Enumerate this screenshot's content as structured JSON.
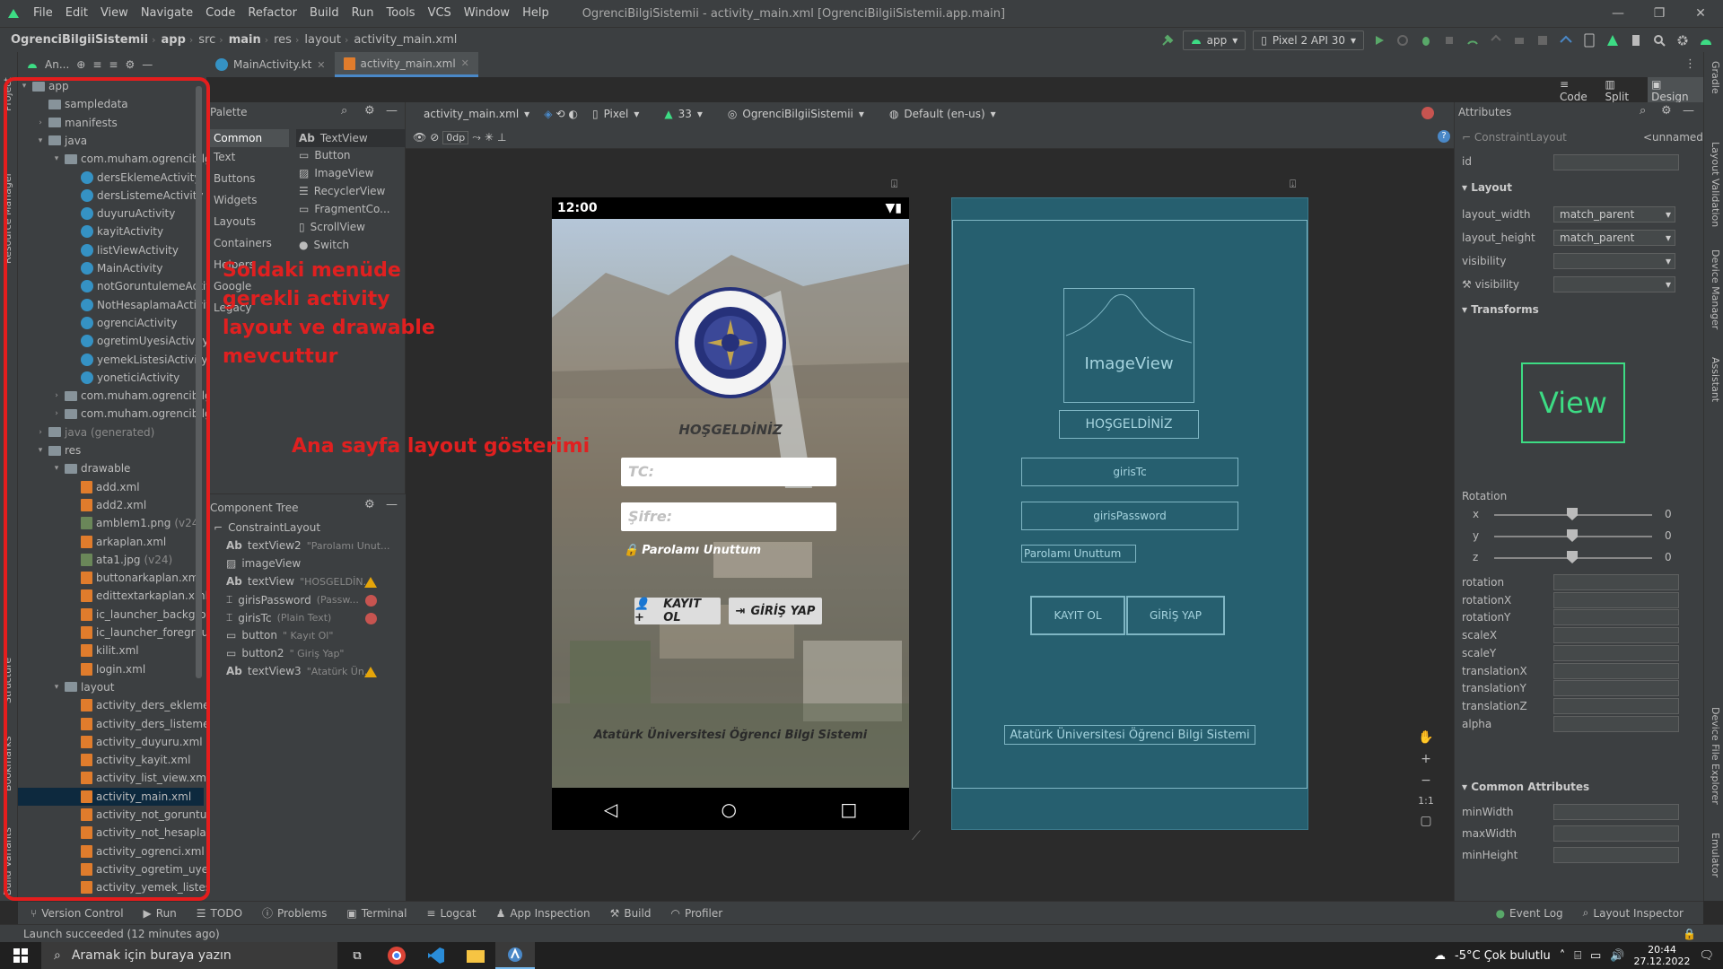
{
  "menubar": {
    "items": [
      "File",
      "Edit",
      "View",
      "Navigate",
      "Code",
      "Refactor",
      "Build",
      "Run",
      "Tools",
      "VCS",
      "Window",
      "Help"
    ],
    "window_title": "OgrenciBilgiSistemii - activity_main.xml [OgrenciBilgiiSistemii.app.main]"
  },
  "breadcrumb": [
    "OgrenciBilgiiSistemii",
    "app",
    "src",
    "main",
    "res",
    "layout",
    "activity_main.xml"
  ],
  "toolbar": {
    "run_config": "app",
    "device": "Pixel 2 API 30"
  },
  "project_tool": {
    "label": "An..."
  },
  "editor_tabs": [
    {
      "label": "MainActivity.kt"
    },
    {
      "label": "activity_main.xml"
    }
  ],
  "view_modes": {
    "code": "Code",
    "split": "Split",
    "design": "Design"
  },
  "left_strip": {
    "project": "Project",
    "resource_manager": "Resource Manager",
    "structure": "Structure",
    "bookmarks": "Bookmarks",
    "build_variants": "Build Variants"
  },
  "right_strip": {
    "gradle": "Gradle",
    "layout_validation": "Layout Validation",
    "device_manager": "Device Manager",
    "assistant": "Assistant",
    "device_file_explorer": "Device File Explorer",
    "emulator": "Emulator"
  },
  "tree": {
    "app": "app",
    "sampledata": "sampledata",
    "manifests": "manifests",
    "java": "java",
    "pkg_main": "com.muham.ogrencibilgiisist",
    "activities": [
      "dersEklemeActivity",
      "dersListemeActivity",
      "duyuruActivity",
      "kayitActivity",
      "listViewActivity",
      "MainActivity",
      "notGoruntulemeActivity",
      "NotHesaplamaActivity",
      "ogrenciActivity",
      "ogretimUyesiActivity",
      "yemekListesiActivity",
      "yoneticiActivity"
    ],
    "pkg_test1": "com.muham.ogrencibilgiisist",
    "pkg_test2": "com.muham.ogrencibilgiisist",
    "java_generated": "java (generated)",
    "res": "res",
    "drawable": "drawable",
    "drawables": [
      "add.xml",
      "add2.xml",
      "amblem1.png",
      "arkaplan.xml",
      "ata1.jpg",
      "buttonarkaplan.xml",
      "edittextarkaplan.xml",
      "ic_launcher_background.x",
      "ic_launcher_foreground.x",
      "kilit.xml",
      "login.xml"
    ],
    "v24": "(v24)",
    "layout": "layout",
    "layouts": [
      "activity_ders_ekleme.xml",
      "activity_ders_listeme.xml",
      "activity_duyuru.xml",
      "activity_kayit.xml",
      "activity_list_view.xml",
      "activity_main.xml",
      "activity_not_goruntuleme",
      "activity_not_hesaplama.xr",
      "activity_ogrenci.xml",
      "activity_ogretim_uyesi.xm",
      "activity_yemek_listesi.xml",
      "activity_yonetici.xml"
    ]
  },
  "palette": {
    "title": "Palette",
    "categories": [
      "Common",
      "Text",
      "Buttons",
      "Widgets",
      "Layouts",
      "Containers",
      "Helpers",
      "Google",
      "Legacy"
    ],
    "items": [
      "TextView",
      "Button",
      "ImageView",
      "RecyclerView",
      "FragmentCo...",
      "ScrollView",
      "Switch"
    ]
  },
  "component_tree": {
    "title": "Component Tree",
    "root": "ConstraintLayout",
    "rows": [
      {
        "name": "textView2",
        "hint": "\"Parolamı Unut..."
      },
      {
        "name": "imageView",
        "hint": ""
      },
      {
        "name": "textView",
        "hint": "\"HOSGELDİN..."
      },
      {
        "name": "girisPassword",
        "hint": "(Passw..."
      },
      {
        "name": "girisTc",
        "hint": "(Plain Text)"
      },
      {
        "name": "button",
        "hint": "\" Kayıt Ol\""
      },
      {
        "name": "button2",
        "hint": "\" Giriş Yap\""
      },
      {
        "name": "textView3",
        "hint": "\"Atatürk Ün..."
      }
    ]
  },
  "design_toolbar": {
    "file": "activity_main.xml",
    "device": "Pixel",
    "api": "33",
    "theme": "OgrenciBilgiiSistemii",
    "locale": "Default (en-us)",
    "margin": "0dp"
  },
  "phone": {
    "time": "12:00",
    "welcome": "HOŞGELDİNİZ",
    "tc_hint": "TC:",
    "password_hint": "Şifre:",
    "forgot": "Parolamı Unuttum",
    "register": "KAYIT OL",
    "login": "GİRİŞ YAP",
    "footer": "Atatürk Üniversitesi Öğrenci Bilgi Sistemi",
    "logo_text": "Atatürk Üniversitesi · Atatürk University"
  },
  "blueprint": {
    "imageview": "ImageView",
    "welcome": "HOŞGELDİNİZ",
    "tc": "girisTc",
    "password": "girisPassword",
    "forgot": "Parolamı Unuttum",
    "register": "KAYIT OL",
    "login": "GİRİŞ YAP",
    "footer": "Atatürk Üniversitesi Öğrenci Bilgi Sistemi"
  },
  "zoom": {
    "ratio": "1:1"
  },
  "attributes": {
    "title": "Attributes",
    "selected": "ConstraintLayout",
    "unnamed": "<unnamed>",
    "id": "id",
    "layout_section": "Layout",
    "layout_width": "layout_width",
    "layout_width_value": "match_parent",
    "layout_height": "layout_height",
    "layout_height_value": "match_parent",
    "visibility": "visibility",
    "tools_visibility": "visibility",
    "transforms": "Transforms",
    "view_preview": "View",
    "rotation_title": "Rotation",
    "axes": [
      "x",
      "y",
      "z"
    ],
    "axis_value": "0",
    "fields": [
      "rotation",
      "rotationX",
      "rotationY",
      "scaleX",
      "scaleY",
      "translationX",
      "translationY",
      "translationZ",
      "alpha"
    ],
    "common": "Common Attributes",
    "common_fields": [
      "minWidth",
      "maxWidth",
      "minHeight"
    ]
  },
  "bottom_tabs": {
    "version_control": "Version Control",
    "run": "Run",
    "todo": "TODO",
    "problems": "Problems",
    "terminal": "Terminal",
    "logcat": "Logcat",
    "app_inspection": "App Inspection",
    "build": "Build",
    "profiler": "Profiler",
    "event_log": "Event Log",
    "layout_inspector": "Layout Inspector"
  },
  "status": "Launch succeeded (12 minutes ago)",
  "taskbar": {
    "search": "Aramak için buraya yazın",
    "weather": "-5°C  Çok bulutlu",
    "time": "20:44",
    "date": "27.12.2022"
  },
  "annotations": {
    "left_lines": [
      "Soldaki menüde",
      "gerekli activity",
      "layout ve drawable",
      "mevcuttur"
    ],
    "center": "Ana sayfa layout gösterimi"
  },
  "colors": {
    "accent": "#4a88c7",
    "annotation": "#e51d1d",
    "blueprint": "#265f6f"
  }
}
